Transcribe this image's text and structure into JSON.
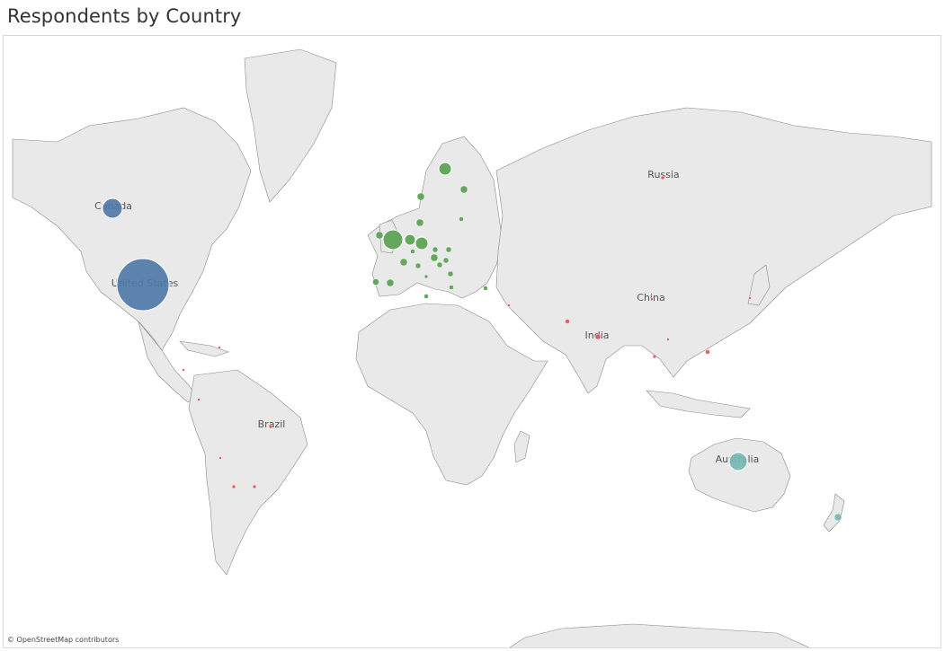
{
  "title": "Respondents by Country",
  "attribution": "© OpenStreetMap contributors",
  "colors": {
    "land": "#e9e9e9",
    "border": "#8a8a8a",
    "water": "#ffffff",
    "americas": "#4e79a7",
    "europe": "#59a14f",
    "asia_other": "#e15759",
    "oceania": "#76b7b2",
    "label": "#555555"
  },
  "country_labels": [
    {
      "name": "Russia"
    },
    {
      "name": "Canada"
    },
    {
      "name": "United States"
    },
    {
      "name": "China"
    },
    {
      "name": "India"
    },
    {
      "name": "Brazil"
    },
    {
      "name": "Australia"
    }
  ],
  "bubble_groups": [
    {
      "group": "americas"
    },
    {
      "group": "europe"
    },
    {
      "group": "asia_other"
    },
    {
      "group": "oceania"
    }
  ]
}
